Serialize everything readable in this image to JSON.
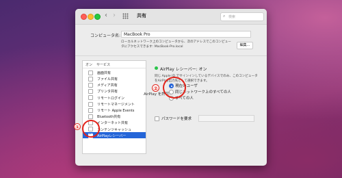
{
  "window": {
    "title": "共有",
    "back_glyph": "‹",
    "forward_glyph": "›",
    "grid_icon": "grid-icon",
    "search_placeholder": "検索"
  },
  "computer_name": {
    "label": "コンピュータ名:",
    "value": "MacBook Pro",
    "description": "ローカルネットワーク上のコンピュータから、次のアドレスでこのコンピュータにアクセスできます: MacBook-Pro.local",
    "edit_button": "編集..."
  },
  "services": {
    "header_on": "オン",
    "header_service": "サービス",
    "items": [
      {
        "label": "画面共有",
        "checked": false,
        "selected": false
      },
      {
        "label": "ファイル共有",
        "checked": false,
        "selected": false
      },
      {
        "label": "メディア共有",
        "checked": false,
        "selected": false
      },
      {
        "label": "プリンタ共有",
        "checked": false,
        "selected": false
      },
      {
        "label": "リモートログイン",
        "checked": false,
        "selected": false
      },
      {
        "label": "リモートマネージメント",
        "checked": false,
        "selected": false
      },
      {
        "label": "リモート Apple Events",
        "checked": false,
        "selected": false
      },
      {
        "label": "Bluetooth共有",
        "checked": false,
        "selected": false
      },
      {
        "label": "インターネット共有",
        "checked": false,
        "selected": false
      },
      {
        "label": "コンテンツキャッシュ",
        "checked": false,
        "selected": false
      },
      {
        "label": "AirPlayレシーバー",
        "checked": true,
        "selected": true
      }
    ]
  },
  "airplay": {
    "status": "AirPlay レシーバー: オン",
    "status_color": "#2bc44a",
    "description": "同じ Apple ID でサインインしているデバイスでのみ、このコンピュータをAirPlay出力先として選択できます。",
    "allow_label": "AirPlay を許可:",
    "options": [
      {
        "label": "現在のユーザ",
        "selected": true
      },
      {
        "label": "同じネットワーク上のすべての人",
        "selected": false
      },
      {
        "label": "すべての人",
        "selected": false
      }
    ],
    "password_label": "パスワードを要求"
  },
  "annotations": {
    "marker_1": "①",
    "marker_2": "②",
    "color": "#e2231a"
  },
  "help": "?"
}
